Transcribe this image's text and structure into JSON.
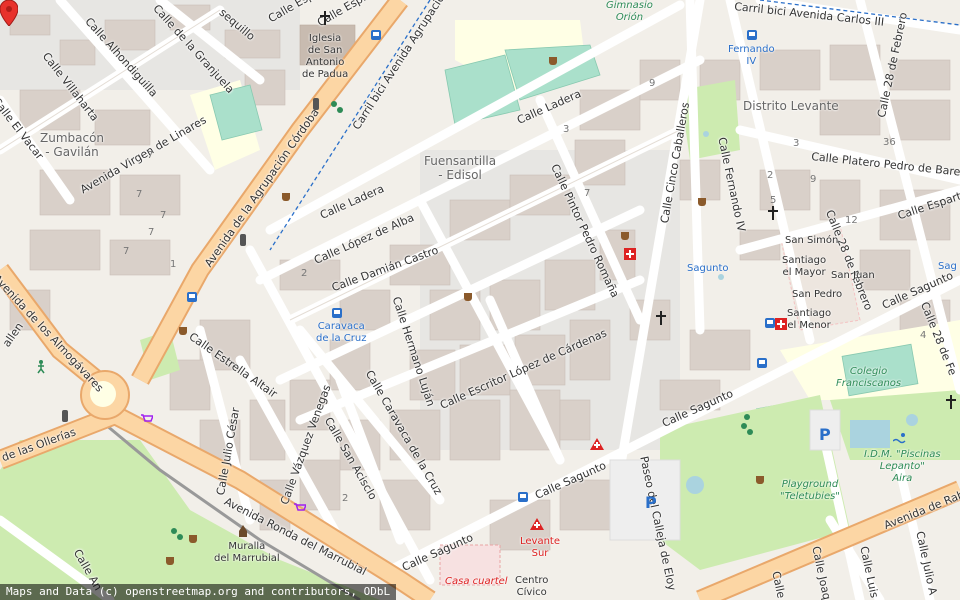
{
  "attribution": "Maps and Data (c) openstreetmap.org and contributors, ODbL",
  "colors": {
    "background": "#f2efe9",
    "building": "#d9d0c9",
    "park": "#cdebb0",
    "pitch": "#aae0cb",
    "primary_road": "#fcd6a4",
    "road": "#ffffff",
    "water": "#aad3df",
    "marker": "#e8322c"
  },
  "streets": {
    "espiel": "Calle Espiel",
    "espiel2": "Calle Espiel",
    "granjuela": "Calle de la Granjuela",
    "alhondiguilla": "Calle Alhondiguilla",
    "villaharta": "Calle Villaharta",
    "vacar": "Calle El Vacar",
    "virgen_linares": "Avenida Virgen de Linares",
    "agrupacion": "Avenida de la Agrupación Córdoba",
    "carril_agrupacion": "Carril bici Avenida Agrupación",
    "ladera": "Calle Ladera",
    "ladera2": "Calle Ladera",
    "lopez_alba": "Calle López de Alba",
    "damian_castro": "Calle Damián Castro",
    "pintor_romana": "Calle Pintor Pedro Romaña",
    "cinco_caballeros": "Calle Cinco Caballeros",
    "fernando_iv": "Calle Fernando IV",
    "carril_carlos": "Carril bici Avenida Carlos III",
    "platero": "Calle Platero Pedro de Bares",
    "febrero": "Calle 28 de Febrero",
    "febrero2": "Calle 28 de Febrero",
    "febrero3": "Calle 28 de Fe",
    "esparta": "Calle Esparta",
    "sagunto": "Calle Sagunto",
    "sagunto2": "Calle Sagunto",
    "sagunto3": "Calle Sagunto",
    "almogavares": "Avenida de los Almogávares",
    "ollerias": "de las Ollerías",
    "estrella": "Calle Estrella Altair",
    "hermano_lujan": "Calle Hermano Luján",
    "escritor": "Calle Escritor López de Cárdenas",
    "caravaca": "Calle Caravaca de la Cruz",
    "san_acisclo": "Calle San Acisclo",
    "vazquez": "Calle Vázquez Venegas",
    "julio_cesar": "Calle Julio César",
    "marrubial": "Avenida Ronda del Marrubial",
    "calleja": "Paseo del Calleja de Eloy",
    "rabanales": "Avenida de Raba",
    "luis": "Calle Luis Va",
    "joaquin": "Calle Joaq",
    "julio_a": "Calle Julio A",
    "calle_an": "Calle An",
    "calle_ba": "Calle Ba",
    "calle_allen": "allen",
    "sequillo": "sequillo"
  },
  "areas": {
    "zumbacon": "Zumbacón\n- Gavilán",
    "fuensantilla": "Fuensantilla\n- Edisol",
    "distrito_levante": "Distrito Levante"
  },
  "pois": {
    "iglesia": "Iglesia\nde San\nAntonio\nde Padua",
    "gimnasio": "Gimnasio\nOrión",
    "fernando_stop": "Fernando\nIV",
    "sagunto_stop": "Sagunto",
    "caravaca_stop": "Caravaca\nde la Cruz",
    "san_simon": "San Simón",
    "santiago_mayor": "Santiago\nel Mayor",
    "san_juan": "San Juan",
    "san_pedro": "San Pedro",
    "santiago_menor": "Santiago\nel Menor",
    "colegio": "Colegio\nFranciscanos",
    "idm": "I.D.M. \"Piscinas\nLepanto\"\nAira",
    "playground": "Playground\n\"Teletubies\"",
    "muralla": "Muralla\ndel Marrubial",
    "levante_sur": "Levante\nSur",
    "centro": "Centro\nCívico",
    "casa": "Casa cuartel",
    "sag_stop2": "Sag"
  },
  "numbers": {
    "n1": "7",
    "n2": "7",
    "n3": "7",
    "n4": "7",
    "n5": "7",
    "n6": "1",
    "n7": "3",
    "n8": "9",
    "n9": "7",
    "n10": "2",
    "n11": "2",
    "n12": "2",
    "n13": "36",
    "n14": "12",
    "n15": "4",
    "n16": "9",
    "n17": "5",
    "n18": "3"
  }
}
